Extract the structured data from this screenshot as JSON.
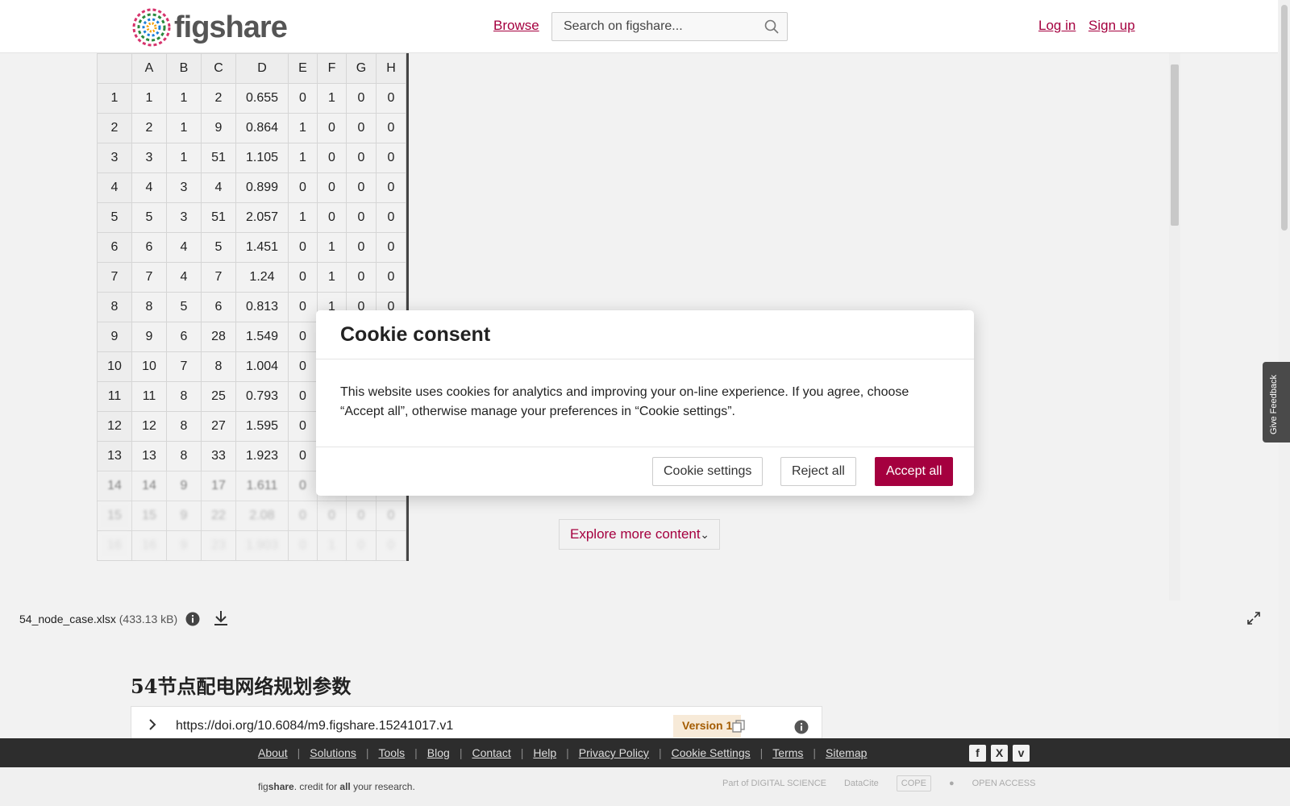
{
  "header": {
    "logo_text": "figshare",
    "browse": "Browse",
    "search_placeholder": "Search on figshare...",
    "login": "Log in",
    "signup": "Sign up"
  },
  "sheet": {
    "columns": [
      "",
      "A",
      "B",
      "C",
      "D",
      "E",
      "F",
      "G",
      "H"
    ],
    "rows": [
      [
        "1",
        "1",
        "1",
        "2",
        "0.655",
        "0",
        "1",
        "0",
        "0"
      ],
      [
        "2",
        "2",
        "1",
        "9",
        "0.864",
        "1",
        "0",
        "0",
        "0"
      ],
      [
        "3",
        "3",
        "1",
        "51",
        "1.105",
        "1",
        "0",
        "0",
        "0"
      ],
      [
        "4",
        "4",
        "3",
        "4",
        "0.899",
        "0",
        "0",
        "0",
        "0"
      ],
      [
        "5",
        "5",
        "3",
        "51",
        "2.057",
        "1",
        "0",
        "0",
        "0"
      ],
      [
        "6",
        "6",
        "4",
        "5",
        "1.451",
        "0",
        "1",
        "0",
        "0"
      ],
      [
        "7",
        "7",
        "4",
        "7",
        "1.24",
        "0",
        "1",
        "0",
        "0"
      ],
      [
        "8",
        "8",
        "5",
        "6",
        "0.813",
        "0",
        "1",
        "0",
        "0"
      ],
      [
        "9",
        "9",
        "6",
        "28",
        "1.549",
        "0",
        "",
        "",
        ""
      ],
      [
        "10",
        "10",
        "7",
        "8",
        "1.004",
        "0",
        "",
        "",
        ""
      ],
      [
        "11",
        "11",
        "8",
        "25",
        "0.793",
        "0",
        "",
        "",
        ""
      ],
      [
        "12",
        "12",
        "8",
        "27",
        "1.595",
        "0",
        "",
        "",
        ""
      ],
      [
        "13",
        "13",
        "8",
        "33",
        "1.923",
        "0",
        "",
        "",
        ""
      ],
      [
        "14",
        "14",
        "9",
        "17",
        "1.611",
        "0",
        "",
        "",
        ""
      ],
      [
        "15",
        "15",
        "9",
        "22",
        "2.08",
        "0",
        "0",
        "0",
        "0"
      ],
      [
        "16",
        "16",
        "9",
        "23",
        "1.903",
        "0",
        "1",
        "0",
        "0"
      ]
    ]
  },
  "explore": "Explore more content",
  "file": {
    "name": "54_node_case.xlsx",
    "size": "(433.13 kB)"
  },
  "item": {
    "title": "54节点配电网络规划参数",
    "doi": "https://doi.org/10.6084/m9.figshare.15241017.v1",
    "version": "Version 1"
  },
  "footer": {
    "links": [
      "About",
      "Solutions",
      "Tools",
      "Blog",
      "Contact",
      "Help",
      "Privacy Policy",
      "Cookie Settings",
      "Terms",
      "Sitemap"
    ],
    "tagline_pre": "fig",
    "tagline_brand": "share",
    "tagline_mid": ". credit for ",
    "tagline_bold": "all",
    "tagline_post": " your research.",
    "social": [
      "f",
      "X",
      "v"
    ],
    "partners": [
      "Part of DIGITAL SCIENCE",
      "DataCite",
      "COPE",
      "",
      "OPEN ACCESS"
    ]
  },
  "feedback": "Give Feedback",
  "cookie": {
    "title": "Cookie consent",
    "body": "This website uses cookies for analytics and improving your on-line experience. If you agree, choose “Accept all”, otherwise manage your preferences in “Cookie settings”.",
    "settings": "Cookie settings",
    "reject": "Reject all",
    "accept": "Accept all"
  },
  "colors": {
    "accent": "#a5003f",
    "footer_bg": "#2d2d2d",
    "version_bg": "#f7ead8",
    "version_text": "#a35b00"
  }
}
